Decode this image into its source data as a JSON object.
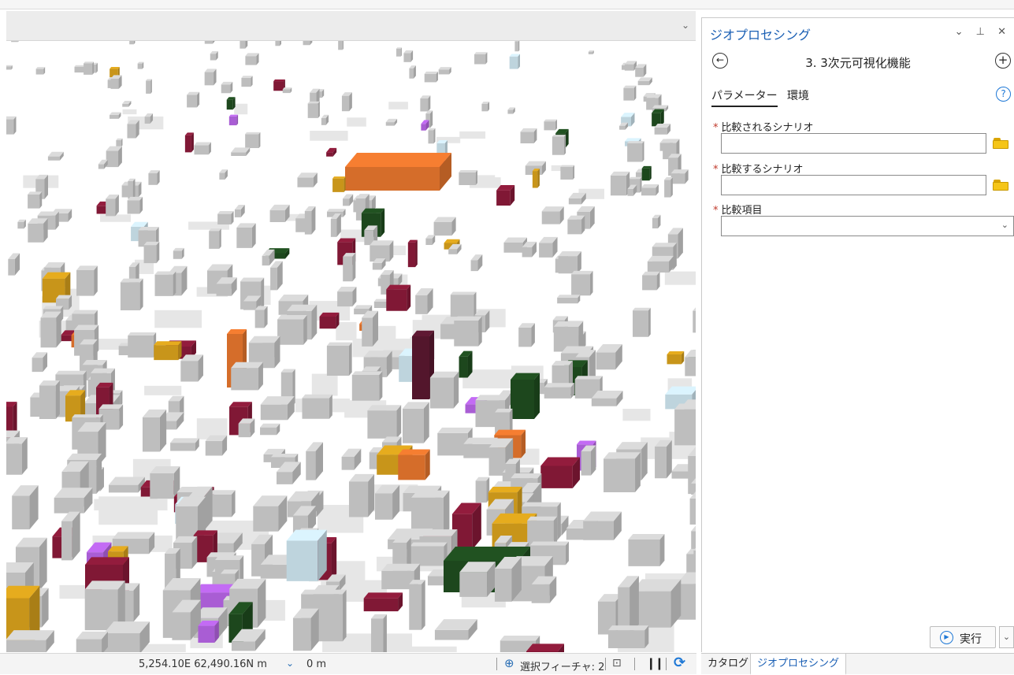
{
  "panel": {
    "title": "ジオプロセシング",
    "title_controls": "⌄ ⊥ ✕",
    "tool_title": "3. 3次元可視化機能",
    "tabs": [
      "パラメーター",
      "環境"
    ],
    "help_label": "?",
    "params": [
      {
        "label": "比較されるシナリオ",
        "value": ""
      },
      {
        "label": "比較するシナリオ",
        "value": ""
      },
      {
        "label": "比較項目",
        "value": ""
      }
    ],
    "required_mark": "*",
    "run_label": "実行"
  },
  "bottom_tabs": [
    "カタログ",
    "ジオプロセシング"
  ],
  "status": {
    "coordinates": "5,254.10E 62,490.16N m",
    "elevation": "0 m",
    "selected_features": "選択フィーチャ: 2"
  },
  "icons": {
    "back": "back-arrow-icon",
    "add": "add-circle-icon",
    "help": "help-icon",
    "folder": "browse-folder-icon",
    "run": "play-icon",
    "select": "select-features-icon",
    "pause": "pause-icon",
    "refresh": "refresh-icon"
  },
  "colors": {
    "accent": "#1a5fb4",
    "building_base": "#cfcfcf",
    "building_highlight": [
      "#8b1a3a",
      "#1f4d1f",
      "#e8772e",
      "#d9a21c",
      "#b865e6",
      "#cfe6f0",
      "#5a1830",
      "#f2eadb"
    ]
  }
}
